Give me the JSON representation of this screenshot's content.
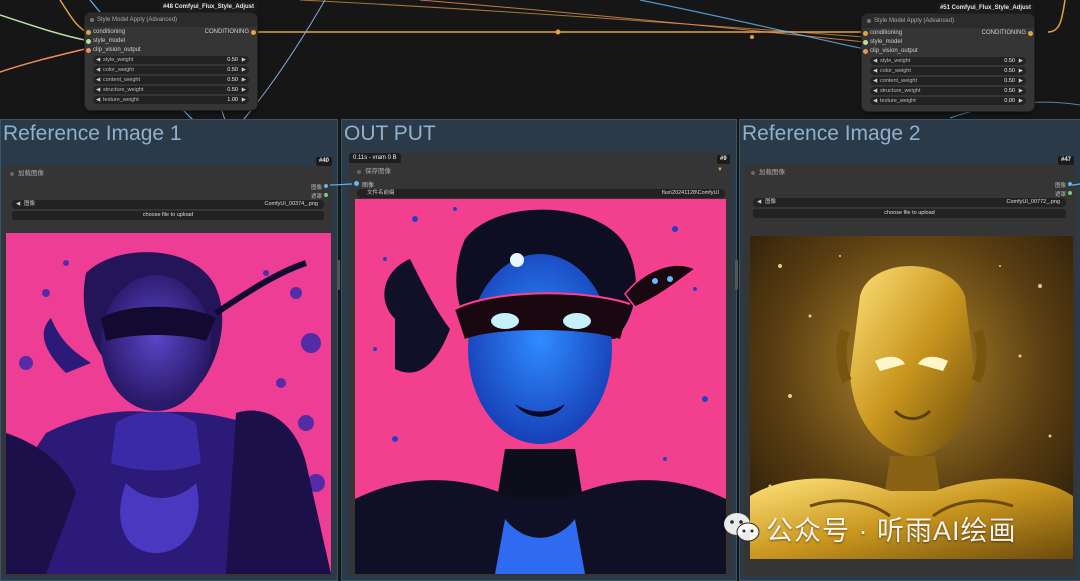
{
  "style_nodes": [
    {
      "badge": "#48 Comfyui_Flux_Style_Adjust",
      "title": "Style Model Apply (Advanced)",
      "inputs": [
        "conditioning",
        "style_model",
        "clip_vision_output"
      ],
      "output": "CONDITIONING",
      "weights": [
        {
          "label": "style_weight",
          "value": "0.50"
        },
        {
          "label": "color_weight",
          "value": "0.50"
        },
        {
          "label": "content_weight",
          "value": "0.50"
        },
        {
          "label": "structure_weight",
          "value": "0.50"
        },
        {
          "label": "texture_weight",
          "value": "1.00"
        }
      ]
    },
    {
      "badge": "#51 Comfyui_Flux_Style_Adjust",
      "title": "Style Model Apply (Advanced)",
      "inputs": [
        "conditioning",
        "style_model",
        "clip_vision_output"
      ],
      "output": "CONDITIONING",
      "weights": [
        {
          "label": "style_weight",
          "value": "0.50"
        },
        {
          "label": "color_weight",
          "value": "0.50"
        },
        {
          "label": "content_weight",
          "value": "0.50"
        },
        {
          "label": "structure_weight",
          "value": "0.50"
        },
        {
          "label": "texture_weight",
          "value": "0.00"
        }
      ]
    }
  ],
  "groups": [
    {
      "title": "Reference Image 1",
      "node_id": "#40",
      "node_title": "加载图像",
      "outputs": [
        "图像",
        "遮罩"
      ],
      "image_label": "图像",
      "image_value": "ComfyUI_00374_.png",
      "upload_label": "choose file to upload"
    },
    {
      "title": "OUT PUT",
      "node_id": "#9",
      "status": "0.11s - vram 0 B",
      "node_title": "保存图像",
      "input": "图像",
      "prefix_label": "文件名前缀",
      "prefix_value": "flux\\20241128\\ComfyUI"
    },
    {
      "title": "Reference Image 2",
      "node_id": "#47",
      "node_title": "加载图像",
      "outputs": [
        "图像",
        "遮罩"
      ],
      "image_label": "图像",
      "image_value": "ComfyUI_00772_.png",
      "upload_label": "choose file to upload"
    }
  ],
  "watermark": "公众号 · 听雨AI绘画",
  "icons": {
    "left_arrow": "◀",
    "right_arrow": "▶",
    "collapse": "▼",
    "wechat": "wechat-icon"
  },
  "colors": {
    "canvas_bg": "#161616",
    "group_bg": "#2a3a48",
    "node_bg": "#353535",
    "wire_conditioning": "#e0a347",
    "wire_image": "#64b5f6",
    "wire_style": "#b6e0a0"
  }
}
